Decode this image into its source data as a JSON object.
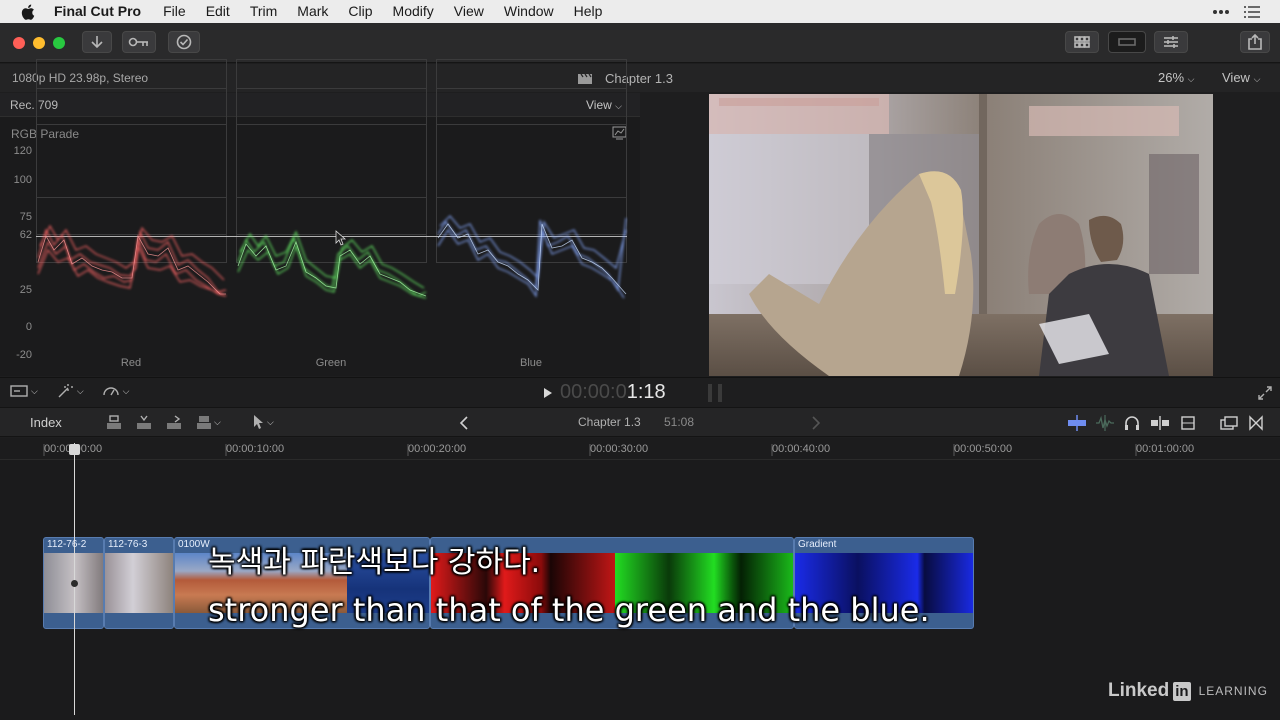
{
  "menubar": {
    "app_name": "Final Cut Pro",
    "items": [
      "File",
      "Edit",
      "Trim",
      "Mark",
      "Clip",
      "Modify",
      "View",
      "Window",
      "Help"
    ]
  },
  "infobar": {
    "format": "1080p HD 23.98p, Stereo",
    "clip_title": "Chapter 1.3",
    "zoom": "26%",
    "view_label": "View"
  },
  "scopes": {
    "color_space": "Rec. 709",
    "view_label": "View",
    "scope_name": "RGB Parade",
    "y_ticks": [
      "120",
      "100",
      "75",
      "62",
      "25",
      "0",
      "-20"
    ],
    "parades": [
      "Red",
      "Green",
      "Blue"
    ]
  },
  "transport": {
    "timecode_dim": "00:00:0",
    "timecode_bright": "1:18"
  },
  "timeline_toolbar": {
    "index_label": "Index",
    "project_name": "Chapter 1.3",
    "duration": "51:08"
  },
  "ruler": {
    "labels": [
      "00:00:00:00",
      "00:00:10:00",
      "00:00:20:00",
      "00:00:30:00",
      "00:00:40:00",
      "00:00:50:00",
      "00:01:00:00"
    ]
  },
  "clips": [
    {
      "name": "112-76-2"
    },
    {
      "name": "112-76-3"
    },
    {
      "name": "0100W"
    },
    {
      "name": ""
    },
    {
      "name": "Gradient"
    }
  ],
  "subtitles": {
    "korean": "녹색과 파란색보다 강하다.",
    "english": "stronger than that of the green and the blue."
  },
  "watermark": {
    "brand": "Linked",
    "brand_box": "in",
    "suffix": "LEARNING"
  },
  "colors": {
    "red_trace": "#ff6b6b",
    "green_trace": "#6bff6b",
    "blue_trace": "#8fb6ff",
    "clip_blue": "#3c5f8f"
  }
}
